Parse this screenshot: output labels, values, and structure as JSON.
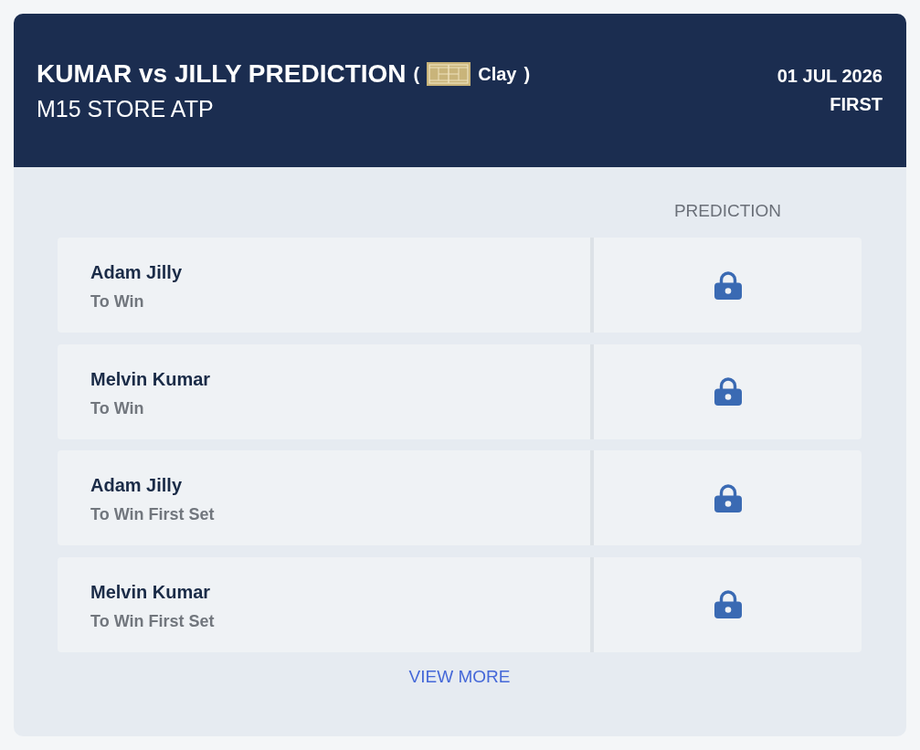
{
  "match": {
    "title": "KUMAR vs JILLY PREDICTION",
    "surface": {
      "open": "(",
      "label": "Clay",
      "close": ")"
    },
    "tournament": "M15 STORE ATP",
    "date": "01 JUL 2026",
    "round": "FIRST"
  },
  "table": {
    "columns": [
      "PREDICTION"
    ],
    "rows": [
      {
        "player": "Adam Jilly",
        "market": "To Win",
        "locked": true
      },
      {
        "player": "Melvin Kumar",
        "market": "To Win",
        "locked": true
      },
      {
        "player": "Adam Jilly",
        "market": "To Win First Set",
        "locked": true
      },
      {
        "player": "Melvin Kumar",
        "market": "To Win First Set",
        "locked": true
      }
    ]
  },
  "view_more": "VIEW MORE"
}
